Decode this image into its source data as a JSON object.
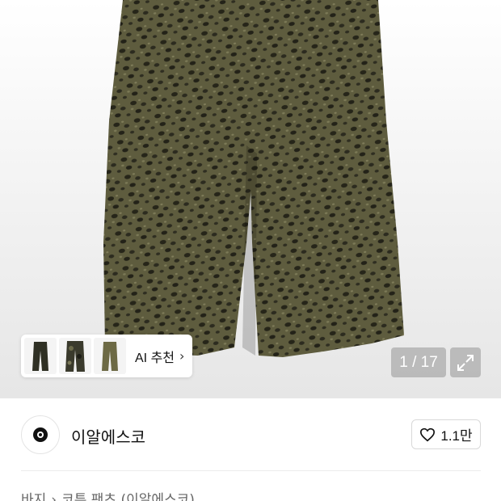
{
  "gallery": {
    "image_alt": "product-photo",
    "counter": "1 / 17",
    "ai_reco_label": "AI 추천",
    "thumbnail_count": 3
  },
  "brand": {
    "name": "이알에스코",
    "likes": "1.1만"
  },
  "breadcrumb": {
    "category": "바지",
    "subcategory": "코튼 팬츠 (이알에스코)"
  },
  "colors": {
    "pants_base": "#5b5a3c",
    "spot": "#2b2a20",
    "overlay": "#969696"
  }
}
